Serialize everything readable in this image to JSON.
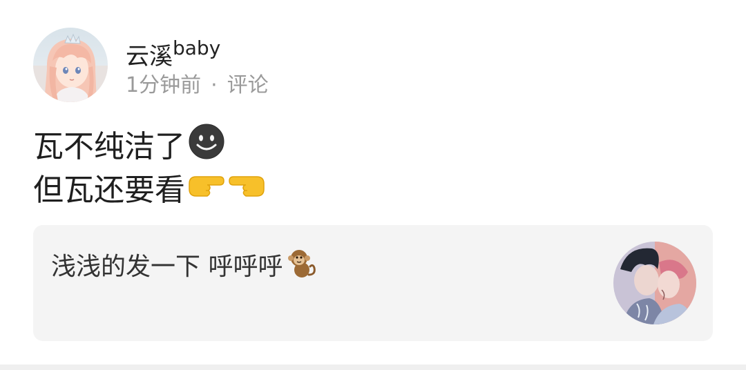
{
  "post": {
    "author": {
      "name": "云溪",
      "name_suffix": "baby",
      "avatar_icon": "anime-girl-avatar"
    },
    "meta": {
      "time": "1分钟前",
      "separator": "·",
      "comment_label": "评论"
    },
    "content": {
      "line1": "瓦不纯洁了",
      "line1_emoji": "dark-smiley-icon",
      "line2": "但瓦还要看",
      "line2_emojis": [
        "pointing-right-icon",
        "pointing-left-icon"
      ]
    },
    "quoted": {
      "text": "浅浅的发一下 呼呼呼",
      "emoji": "monkey-icon",
      "thumbnail_icon": "comic-couple-thumbnail"
    }
  },
  "colors": {
    "background": "#ffffff",
    "card_background": "#f4f4f4",
    "meta_text": "#9a9a9a",
    "primary_text": "#1f1f1f"
  }
}
